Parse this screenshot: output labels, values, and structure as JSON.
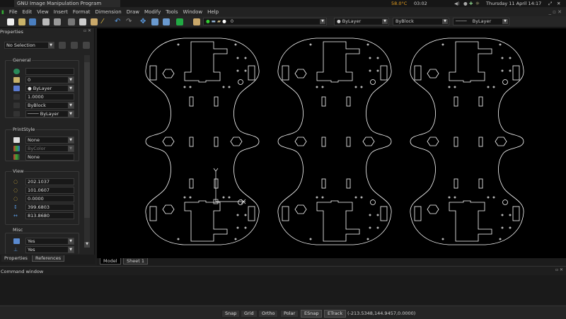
{
  "titlebar": {
    "app_title": "GNU Image Manipulation Program",
    "temperature": "58.0°C",
    "time_small": "03:02",
    "datetime": "Thursday 11 April 14:17"
  },
  "menu": [
    "File",
    "Edit",
    "View",
    "Insert",
    "Format",
    "Dimension",
    "Draw",
    "Modify",
    "Tools",
    "Window",
    "Help"
  ],
  "toolbar": {
    "layer": "0",
    "color": "ByLayer",
    "linetype": "ByBlock",
    "lineweight": "ByLayer"
  },
  "properties": {
    "title": "Properties",
    "selection": "No Selection",
    "general": {
      "label": "General",
      "layer": "0",
      "color": "ByLayer",
      "scale": "1.0000",
      "linetype": "ByBlock",
      "lineweight": "ByLayer"
    },
    "printstyle": {
      "label": "PrintStyle",
      "style": "None",
      "color": "ByColor",
      "table": "None"
    },
    "view": {
      "label": "View",
      "cx": "202.1037",
      "cy": "101.0607",
      "cz": "0.0000",
      "height": "399.6803",
      "width": "813.8680"
    },
    "misc": {
      "label": "Misc",
      "a": "Yes",
      "b": "Yes"
    },
    "tabs": [
      "Properties",
      "References"
    ]
  },
  "canvas_tabs": [
    "Model",
    "Sheet 1"
  ],
  "command": {
    "title": "Command window"
  },
  "status": {
    "buttons": [
      "Snap",
      "Grid",
      "Ortho",
      "Polar",
      "ESnap",
      "ETrack"
    ],
    "coords": "(-213.5348,144.9457,0.0000)"
  },
  "colors": {
    "canvas": "#000000",
    "lines": "#ffffff",
    "accent": "#e8a020"
  }
}
